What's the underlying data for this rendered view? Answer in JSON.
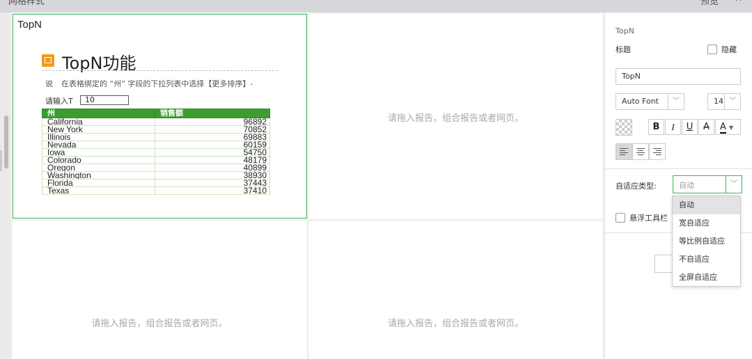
{
  "topbar": {
    "left_title": "网格样式",
    "right_text": "预览"
  },
  "canvas": {
    "cells": [
      {
        "title": "TopN"
      },
      {
        "placeholder": "请拖入报告，组合报告或者网页。"
      },
      {
        "placeholder": "请拖入报告，组合报告或者网页。"
      },
      {
        "placeholder": "请拖入报告，组合报告或者网页。"
      }
    ],
    "report": {
      "heading": "TopN功能",
      "desc_a": "说",
      "desc_b": "在表格绑定的 “州” 字段的下拉列表中选择【更多排序】-",
      "input_label": "请输入T",
      "input_value": "10",
      "table": {
        "headers": [
          "州",
          "销售额"
        ],
        "rows": [
          [
            "California",
            "96892"
          ],
          [
            "New York",
            "70852"
          ],
          [
            "Illinois",
            "69883"
          ],
          [
            "Nevada",
            "60159"
          ],
          [
            "Iowa",
            "54750"
          ],
          [
            "Colorado",
            "48179"
          ],
          [
            "Oregon",
            "40899"
          ],
          [
            "Washington",
            "38930"
          ],
          [
            "Florida",
            "37443"
          ],
          [
            "Texas",
            "37410"
          ]
        ]
      }
    }
  },
  "panel": {
    "component_name": "TopN",
    "title_label": "标题",
    "hide_label": "隐藏",
    "title_value": "TopN",
    "font_family": "Auto Font",
    "font_size": "14",
    "format_buttons": [
      "B",
      "I",
      "U",
      "A",
      "A"
    ],
    "adapt_label": "自适应类型:",
    "adapt_value": "自动",
    "float_toolbar_label": "悬浮工具栏",
    "adapt_options": [
      "自动",
      "宽自适应",
      "等比例自适应",
      "不自适应",
      "全屏自适应"
    ],
    "accent_color": "#3db35c",
    "header_green": "#3c9c2f"
  }
}
